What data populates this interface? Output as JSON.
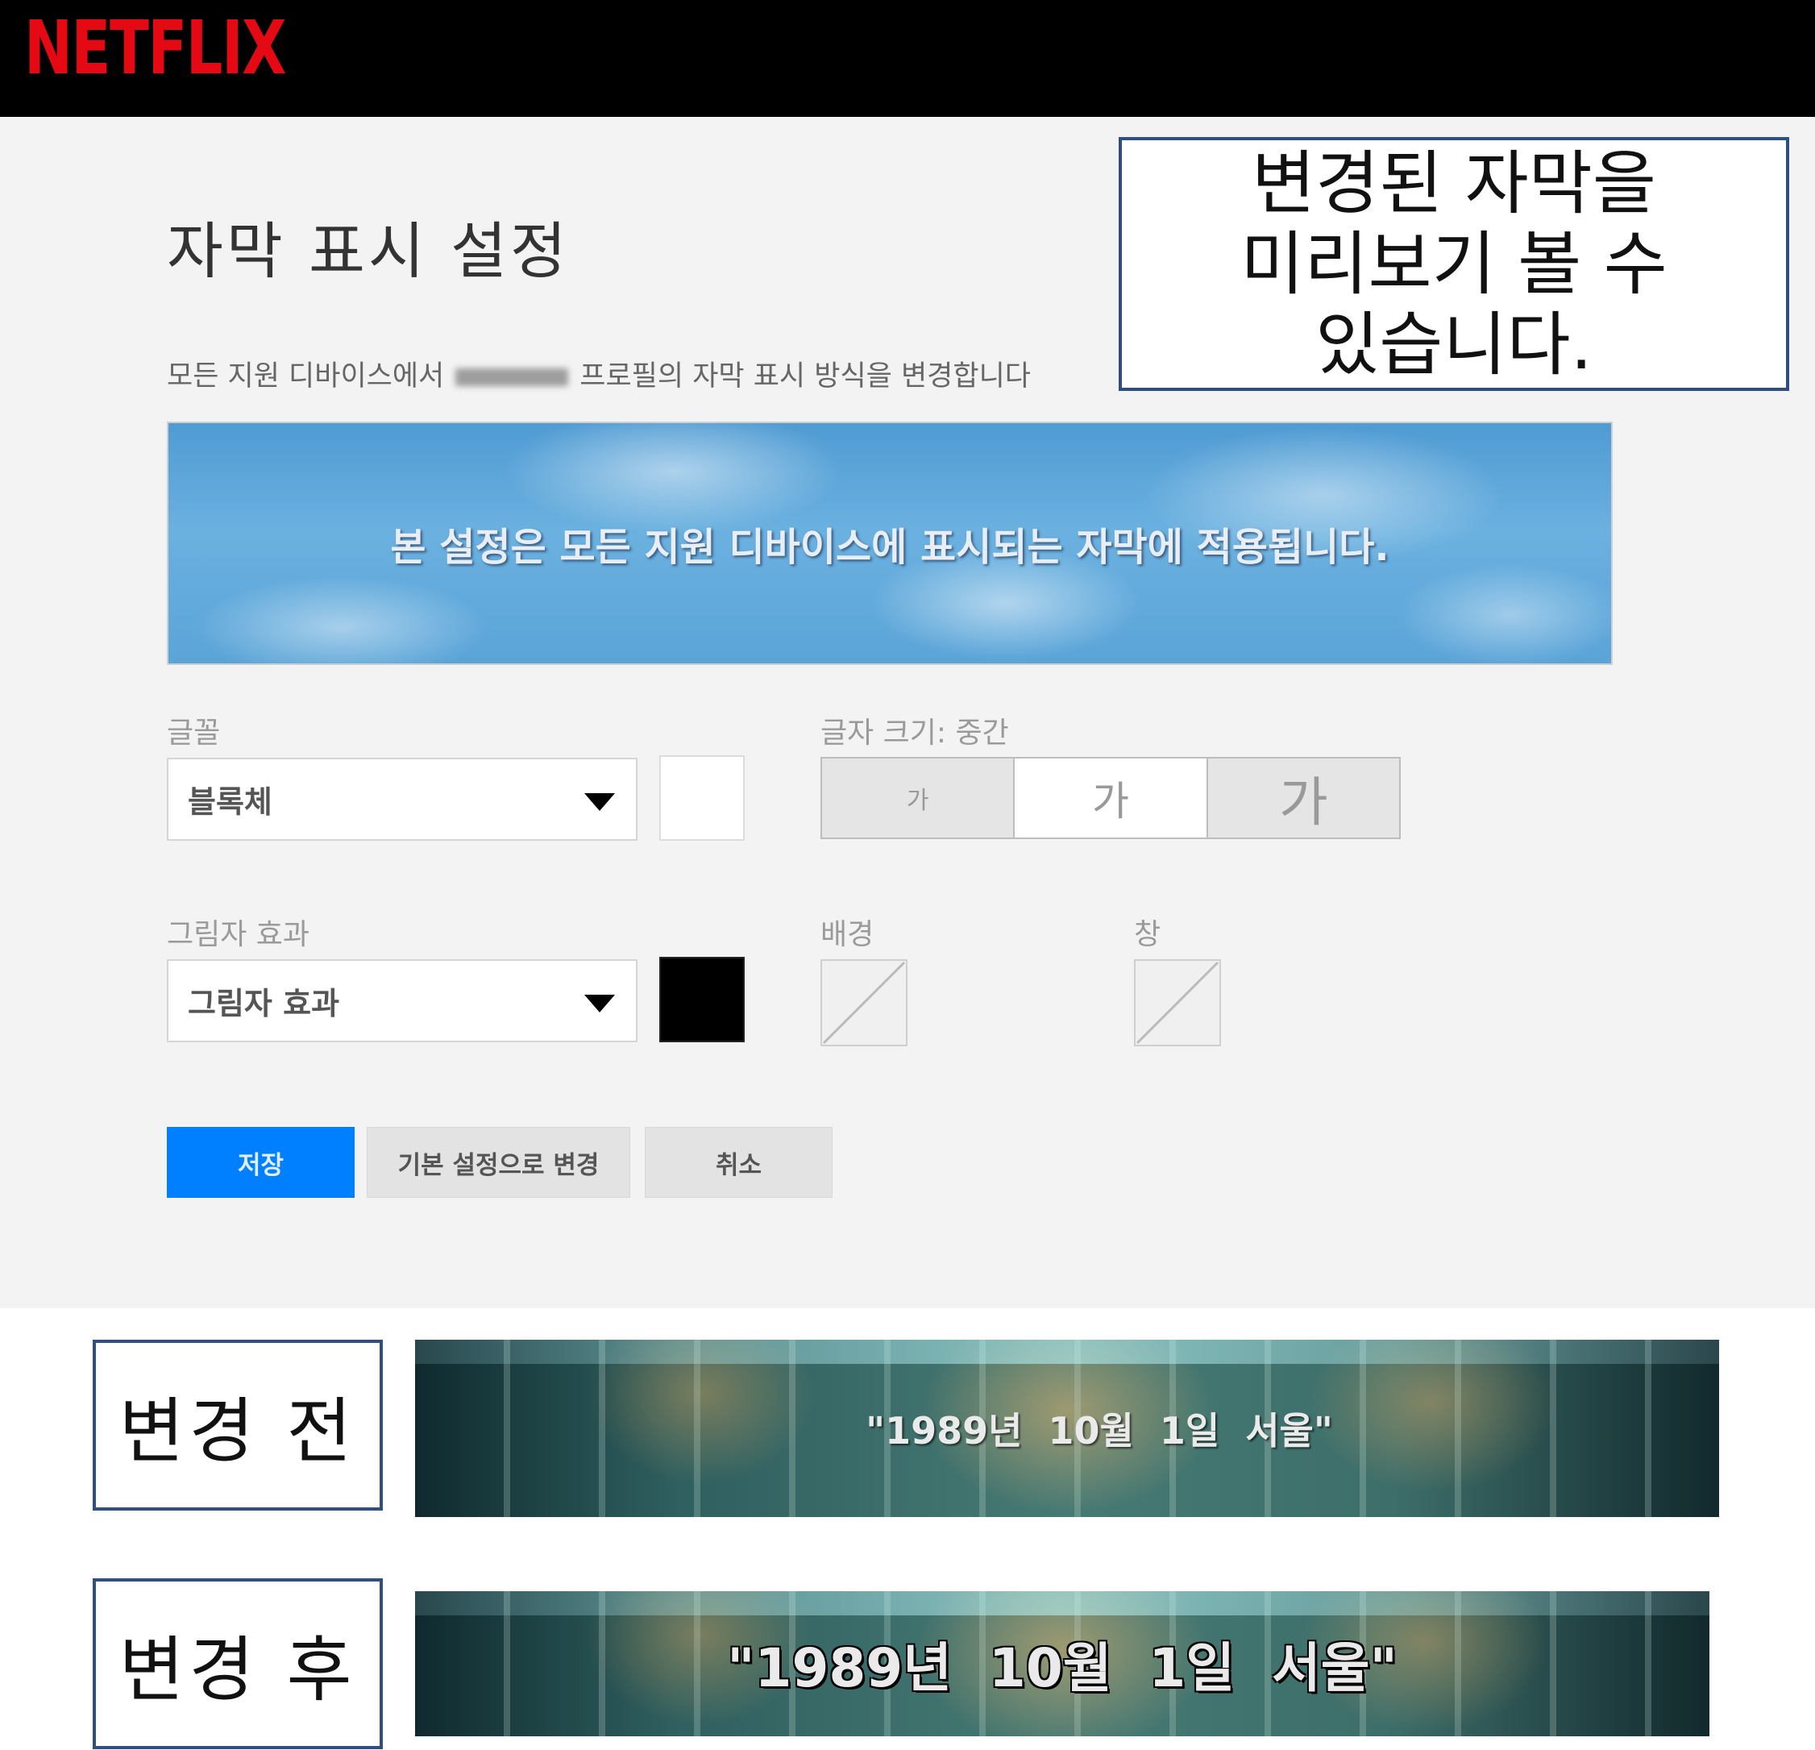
{
  "header": {
    "logo": "NETFLIX"
  },
  "page": {
    "title": "자막 표시 설정",
    "description_before": "모든 지원 디바이스에서",
    "description_after": "프로필의 자막 표시 방식을 변경합니다"
  },
  "callout": {
    "text": "변경된 자막을\n미리보기 볼 수\n있습니다."
  },
  "preview": {
    "text": "본 설정은 모든 지원 디바이스에 표시되는 자막에 적용됩니다."
  },
  "font": {
    "label": "글꼴",
    "selected": "블록체",
    "color": "#ffffff"
  },
  "size": {
    "label": "글자 크기: 중간",
    "options": [
      "가",
      "가",
      "가"
    ],
    "selected_index": 1
  },
  "shadow": {
    "label": "그림자 효과",
    "selected": "그림자 효과",
    "color": "#000000"
  },
  "background": {
    "label": "배경"
  },
  "window": {
    "label": "창"
  },
  "buttons": {
    "save": "저장",
    "reset": "기본 설정으로 변경",
    "cancel": "취소"
  },
  "comparison": {
    "before_label": "변경 전",
    "after_label": "변경 후",
    "subtitle_before": "\"1989년  10월  1일  서울\"",
    "subtitle_after": "\"1989년  10월  1일  서울\""
  },
  "colors": {
    "brand": "#e50914",
    "primary_button": "#0080ff",
    "callout_border": "#2f4f7f"
  }
}
